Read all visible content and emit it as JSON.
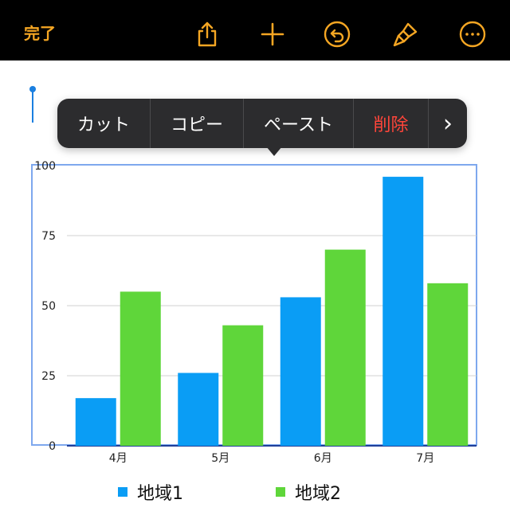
{
  "toolbar": {
    "done_label": "完了",
    "icons": [
      "share-icon",
      "add-icon",
      "undo-icon",
      "format-brush-icon",
      "more-icon"
    ],
    "accent": "#f5a623"
  },
  "context_menu": {
    "items": [
      {
        "label": "カット"
      },
      {
        "label": "コピー"
      },
      {
        "label": "ペースト"
      },
      {
        "label": "削除"
      }
    ],
    "more_label": "›"
  },
  "chart_data": {
    "type": "bar",
    "categories": [
      "4月",
      "5月",
      "6月",
      "7月"
    ],
    "series": [
      {
        "name": "地域1",
        "values": [
          17,
          26,
          53,
          96
        ],
        "color": "#0a9df5"
      },
      {
        "name": "地域2",
        "values": [
          55,
          43,
          70,
          58
        ],
        "color": "#5fd63a"
      }
    ],
    "ylim": [
      0,
      100
    ],
    "yticks": [
      "0",
      "25",
      "50",
      "75",
      "100"
    ],
    "grid": true,
    "legend": "bottom"
  }
}
